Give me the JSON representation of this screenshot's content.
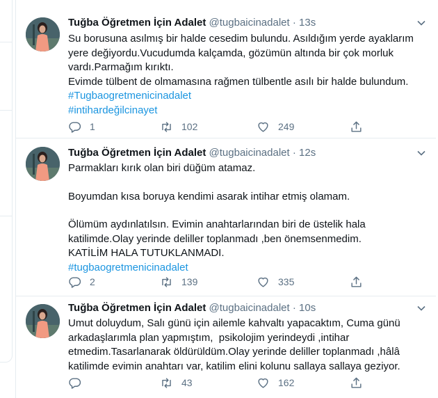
{
  "tweets": [
    {
      "name": "Tuğba Öğretmen İçin Adalet",
      "handle": "@tugbaicinadalet",
      "dot": "·",
      "time": "13s",
      "lines": [
        "Su borusuna asılmış bir halde cesedim bulundu. Asıldığım yerde ayaklarım",
        "yere değiyordu.Vucudumda kalçamda, gözümün altında bir çok morluk",
        "vardı.Parmağım kırıktı.",
        "Evimde tülbent de olmamasına rağmen tülbentle asılı bir halde bulundum."
      ],
      "hashtags": [
        "#Tugbaogretmenicinadalet",
        "#intihardeğilcinayet"
      ],
      "reply_count": "1",
      "retweet_count": "102",
      "like_count": "249"
    },
    {
      "name": "Tuğba Öğretmen İçin Adalet",
      "handle": "@tugbaicinadalet",
      "dot": "·",
      "time": "12s",
      "paragraphs": [
        [
          "Parmakları kırık olan biri düğüm atamaz."
        ],
        [
          "Boyumdan kısa boruya kendimi asarak intihar etmiş olamam."
        ],
        [
          "Ölümüm aydınlatılsın. Evimin anahtarlarından biri de üstelik hala",
          "katilimde.Olay yerinde deliller toplanmadı ,ben önemsenmedim.",
          "KATİLİM HALA TUTUKLANMADI."
        ]
      ],
      "hashtags": [
        "#tugbaogretmenicinadalet"
      ],
      "reply_count": "2",
      "retweet_count": "139",
      "like_count": "335"
    },
    {
      "name": "Tuğba Öğretmen İçin Adalet",
      "handle": "@tugbaicinadalet",
      "dot": "·",
      "time": "10s",
      "lines": [
        "Umut doluydum, Salı günü için ailemle kahvaltı yapacaktım, Cuma günü",
        "arkadaşlarımla plan yapmıştım,  psikolojim yerindeydi ,intihar",
        "etmedim.Tasarlanarak öldürüldüm.Olay yerinde deliller toplanmadı ,hâlâ",
        "katilimde evimin anahtarı var, katilim elini kolunu sallaya sallaya geziyor."
      ],
      "hashtags": [],
      "reply_count": "",
      "retweet_count": "43",
      "like_count": "162"
    }
  ],
  "icons": {
    "reply": "reply-icon",
    "retweet": "retweet-icon",
    "like": "heart-icon",
    "share": "share-icon",
    "more": "chevron-down-icon"
  },
  "colors": {
    "link": "#1b95e0",
    "secondary": "#5b7083",
    "border": "#e6ecf0"
  }
}
